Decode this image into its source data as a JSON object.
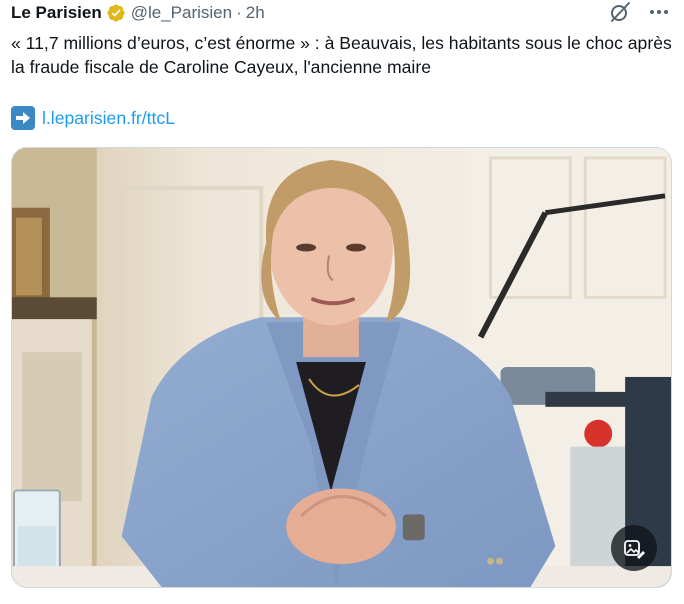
{
  "tweet": {
    "author_name": "Le Parisien",
    "handle": "@le_Parisien",
    "separator": "·",
    "time": "2h",
    "text": "« 11,7 millions d’euros, c’est énorme » : à Beauvais, les habitants sous le choc après la fraude fiscale de Caroline Cayeux, l'ancienne maire",
    "link_text": "l.leparisien.fr/ttcL"
  },
  "icons": {
    "verified": "verified-badge-gold-icon",
    "grok": "grok-icon",
    "more": "more-options-icon",
    "link_arrow": "right-arrow-emoji-icon",
    "image_edit": "image-edit-icon"
  },
  "colors": {
    "text": "#0f1419",
    "muted": "#536471",
    "link": "#1d9bf0",
    "verified_gold": "#e2b719",
    "arrow_box": "#3b88c3"
  }
}
